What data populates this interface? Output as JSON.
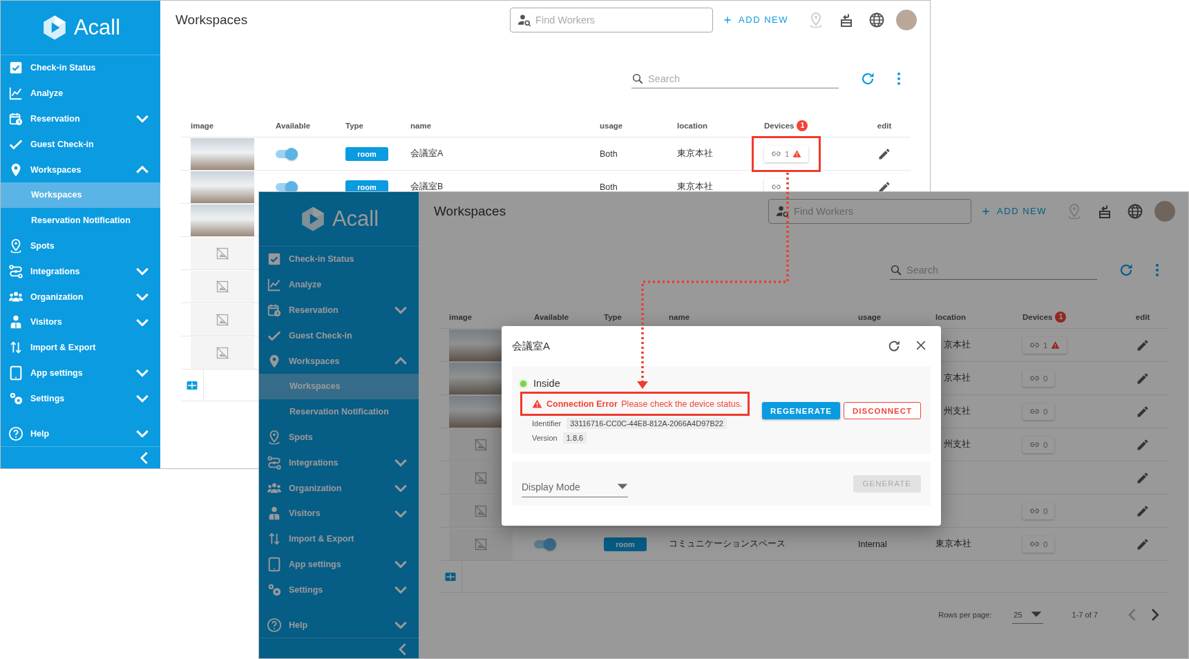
{
  "screens": [
    {
      "sidebar": {
        "logo": "Acall",
        "items": [
          {
            "label": "Check-in Status",
            "kind": "link"
          },
          {
            "label": "Analyze",
            "kind": "link"
          },
          {
            "label": "Reservation",
            "kind": "group",
            "expanded": false
          },
          {
            "label": "Guest Check-in",
            "kind": "link"
          },
          {
            "label": "Workspaces",
            "kind": "group",
            "expanded": true,
            "children": [
              {
                "label": "Workspaces",
                "selected": true
              },
              {
                "label": "Reservation Notification",
                "selected": false
              }
            ]
          },
          {
            "label": "Spots",
            "kind": "link"
          },
          {
            "label": "Integrations",
            "kind": "group",
            "expanded": false
          },
          {
            "label": "Organization",
            "kind": "group",
            "expanded": false
          },
          {
            "label": "Visitors",
            "kind": "group",
            "expanded": false
          },
          {
            "label": "Import & Export",
            "kind": "link"
          },
          {
            "label": "App settings",
            "kind": "group",
            "expanded": false
          },
          {
            "label": "Settings",
            "kind": "group",
            "expanded": false
          }
        ],
        "help": {
          "label": "Help",
          "kind": "group",
          "expanded": false
        }
      },
      "header": {
        "title": "Workspaces",
        "find_workers": {
          "placeholder": "Find Workers"
        },
        "add_new": "ADD NEW"
      },
      "search": {
        "placeholder": "Search"
      },
      "table": {
        "columns": [
          "image",
          "Available",
          "Type",
          "name",
          "usage",
          "location",
          "Devices",
          "edit"
        ],
        "devices_badge": "1",
        "rows": [
          {
            "kind": "full",
            "has_photo": true,
            "available": true,
            "type": "room",
            "name": "会議室A",
            "usage": "Both",
            "location": "東京本社",
            "devices": {
              "count": "1",
              "warning": true,
              "highlighted": true
            }
          },
          {
            "kind": "full",
            "has_photo": true,
            "available": true,
            "type": "room",
            "name": "会議室B",
            "usage": "Both",
            "location": "東京本社",
            "devices": {
              "warning": false,
              "highlighted": false
            }
          },
          {
            "kind": "image_only",
            "has_photo": true
          },
          {
            "kind": "image_only",
            "has_photo": false
          },
          {
            "kind": "image_only",
            "has_photo": false
          },
          {
            "kind": "image_only",
            "has_photo": false
          },
          {
            "kind": "image_only",
            "has_photo": false
          }
        ]
      }
    },
    {
      "sidebar": {
        "logo": "Acall",
        "items": [
          {
            "label": "Check-in Status",
            "kind": "link"
          },
          {
            "label": "Analyze",
            "kind": "link"
          },
          {
            "label": "Reservation",
            "kind": "group",
            "expanded": false
          },
          {
            "label": "Guest Check-in",
            "kind": "link"
          },
          {
            "label": "Workspaces",
            "kind": "group",
            "expanded": true,
            "children": [
              {
                "label": "Workspaces",
                "selected": true
              },
              {
                "label": "Reservation Notification",
                "selected": false
              }
            ]
          },
          {
            "label": "Spots",
            "kind": "link"
          },
          {
            "label": "Integrations",
            "kind": "group",
            "expanded": false
          },
          {
            "label": "Organization",
            "kind": "group",
            "expanded": false
          },
          {
            "label": "Visitors",
            "kind": "group",
            "expanded": false
          },
          {
            "label": "Import & Export",
            "kind": "link"
          },
          {
            "label": "App settings",
            "kind": "group",
            "expanded": false
          },
          {
            "label": "Settings",
            "kind": "group",
            "expanded": false
          }
        ],
        "help": {
          "label": "Help",
          "kind": "group",
          "expanded": false
        }
      },
      "header": {
        "title": "Workspaces",
        "find_workers": {
          "placeholder": "Find Workers"
        },
        "add_new": "ADD NEW"
      },
      "search": {
        "placeholder": "Search"
      },
      "table": {
        "columns": [
          "image",
          "Available",
          "Type",
          "name",
          "usage",
          "location",
          "Devices",
          "edit"
        ],
        "devices_badge": "1",
        "rows": [
          {
            "kind": "partial",
            "has_photo": true,
            "location": "京本社",
            "devices": {
              "count": "1",
              "warning": true
            }
          },
          {
            "kind": "partial",
            "has_photo": true,
            "location": "京本社",
            "devices": {
              "count": "0",
              "warning": false
            }
          },
          {
            "kind": "partial",
            "has_photo": true,
            "location": "州支社",
            "devices": {
              "count": "0",
              "warning": false
            }
          },
          {
            "kind": "partial",
            "has_photo": false,
            "location": "州支社",
            "devices": {
              "count": "0",
              "warning": false
            }
          },
          {
            "kind": "partial",
            "has_photo": false
          },
          {
            "kind": "partial",
            "has_photo": false,
            "devices": {
              "count": "0",
              "warning": false
            }
          },
          {
            "kind": "full",
            "has_photo": false,
            "available": true,
            "type": "room",
            "name": "コミュニケーションスペース",
            "usage": "Internal",
            "location": "東京本社",
            "devices": {
              "count": "0",
              "warning": false
            }
          }
        ]
      },
      "pagination": {
        "rows_per_page_label": "Rows per page:",
        "rows_per_page": "25",
        "range": "1-7 of 7"
      },
      "dialog": {
        "title": "会議室A",
        "status": {
          "label": "Inside",
          "connected": true
        },
        "error": {
          "text": "**Connection Error** Please check the device status.",
          "highlighted": true
        },
        "identifier": {
          "label": "Identifier",
          "value": "33116716-CC0C-44E8-812A-2066A4D97B22"
        },
        "version": {
          "label": "Version",
          "value": "1.8.6"
        },
        "buttons": [
          {
            "label": "REGENERATE",
            "kind": "primary"
          },
          {
            "label": "DISCONNECT",
            "kind": "danger"
          }
        ],
        "display_mode": {
          "label": "Display Mode"
        },
        "generate": {
          "label": "GENERATE",
          "disabled": true
        }
      }
    }
  ]
}
